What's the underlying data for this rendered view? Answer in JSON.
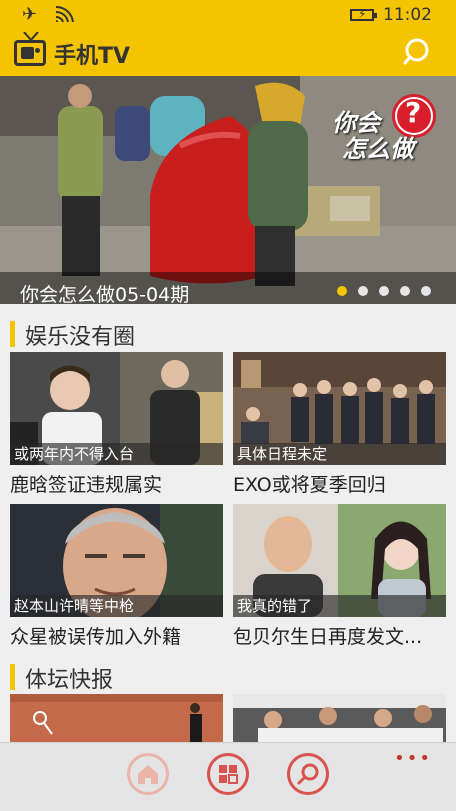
{
  "status": {
    "time": "11:02",
    "icons": [
      "airplane-icon",
      "wifi-icon",
      "battery-charging-icon"
    ]
  },
  "appbar": {
    "title": "手机TV",
    "icons": [
      "tv-logo-icon",
      "search-icon"
    ]
  },
  "banner": {
    "title": "你会怎么做05-04期",
    "logo_text_1": "你会",
    "logo_text_2": "怎么做",
    "logo_mark": "?",
    "slide_count": 5,
    "active_slide": 1
  },
  "sections": {
    "entertainment": {
      "label": "娱乐没有圈",
      "cards": [
        {
          "caption": "或两年内不得入台",
          "title": "鹿晗签证违规属实"
        },
        {
          "caption": "具体日程未定",
          "title": "EXO或将夏季回归"
        },
        {
          "caption": "赵本山许晴等中枪",
          "title": "众星被误传加入外籍"
        },
        {
          "caption": "我真的错了",
          "title": "包贝尔生日再度发文..."
        }
      ]
    },
    "sports": {
      "label": "体坛快报"
    }
  },
  "bottom_nav": {
    "items": [
      "home-icon",
      "categories-icon",
      "search-icon"
    ],
    "more": "•••"
  },
  "colors": {
    "accent": "#f5c400",
    "nav_red": "#d9534f"
  }
}
